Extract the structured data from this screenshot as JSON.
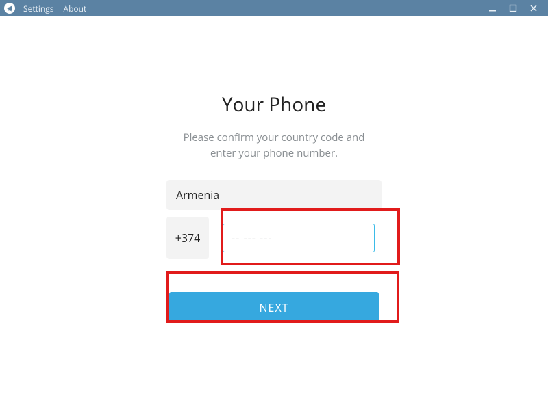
{
  "titlebar": {
    "menu": {
      "settings": "Settings",
      "about": "About"
    }
  },
  "page": {
    "heading": "Your Phone",
    "subtitle": "Please confirm your country code and\nenter your phone number."
  },
  "form": {
    "country": "Armenia",
    "dial_code": "+374",
    "phone_value": "",
    "phone_placeholder": "-- --- ---",
    "next_label": "NEXT"
  },
  "colors": {
    "titlebar_bg": "#5b82a3",
    "accent": "#36a8df",
    "highlight": "#e11b1b",
    "field_bg": "#f3f3f3",
    "text_muted": "#8a8f93"
  }
}
